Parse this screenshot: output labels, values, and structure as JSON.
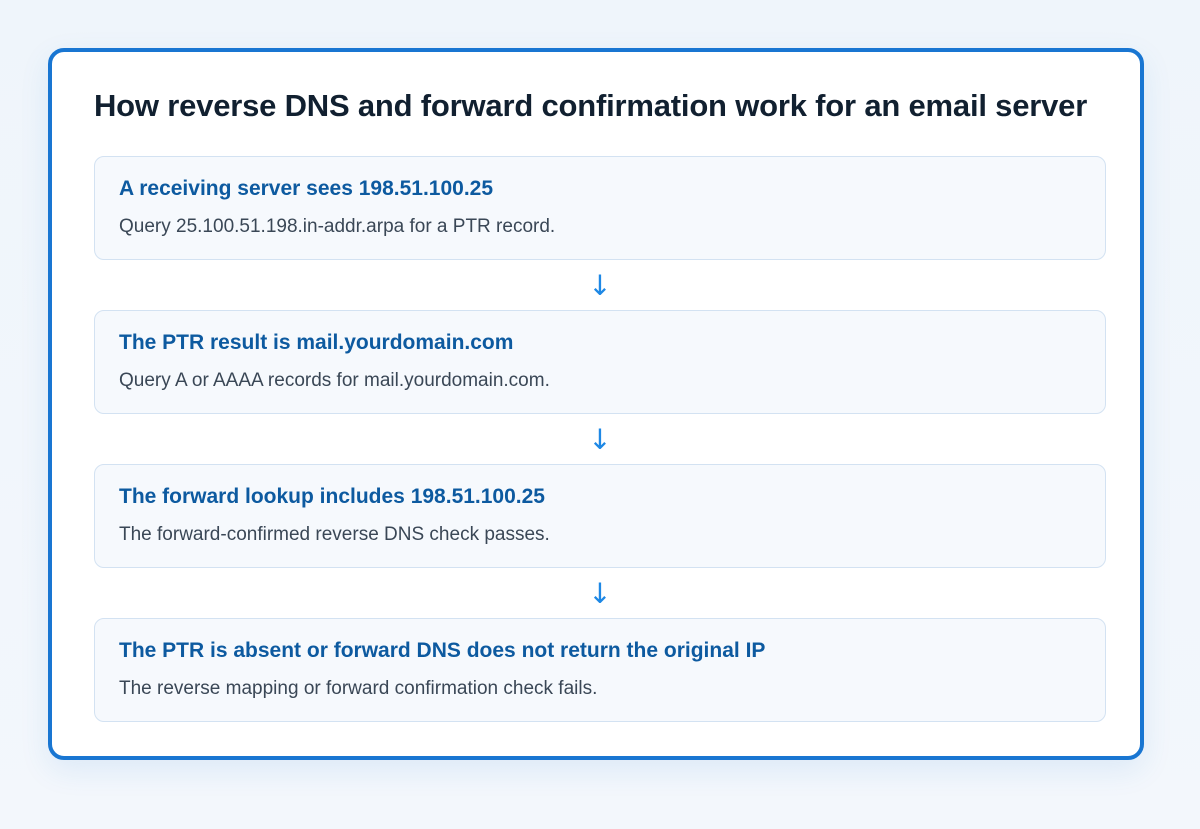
{
  "title": "How reverse DNS and forward confirmation work for an email server",
  "steps": [
    {
      "heading": "A receiving server sees 198.51.100.25",
      "description": "Query 25.100.51.198.in-addr.arpa for a PTR record."
    },
    {
      "heading": "The PTR result is mail.yourdomain.com",
      "description": "Query A or AAAA records for mail.yourdomain.com."
    },
    {
      "heading": "The forward lookup includes 198.51.100.25",
      "description": "The forward-confirmed reverse DNS check passes."
    },
    {
      "heading": "The PTR is absent or forward DNS does not return the original IP",
      "description": "The reverse mapping or forward confirmation check fails."
    }
  ],
  "arrow_glyph": "↓",
  "colors": {
    "accent": "#1976d2",
    "heading": "#0d5aa0",
    "title": "#112030",
    "body_text": "#3a4756",
    "step_background": "#f6f9fd",
    "step_border": "#d3e2f2",
    "arrow": "#1e88e5"
  }
}
